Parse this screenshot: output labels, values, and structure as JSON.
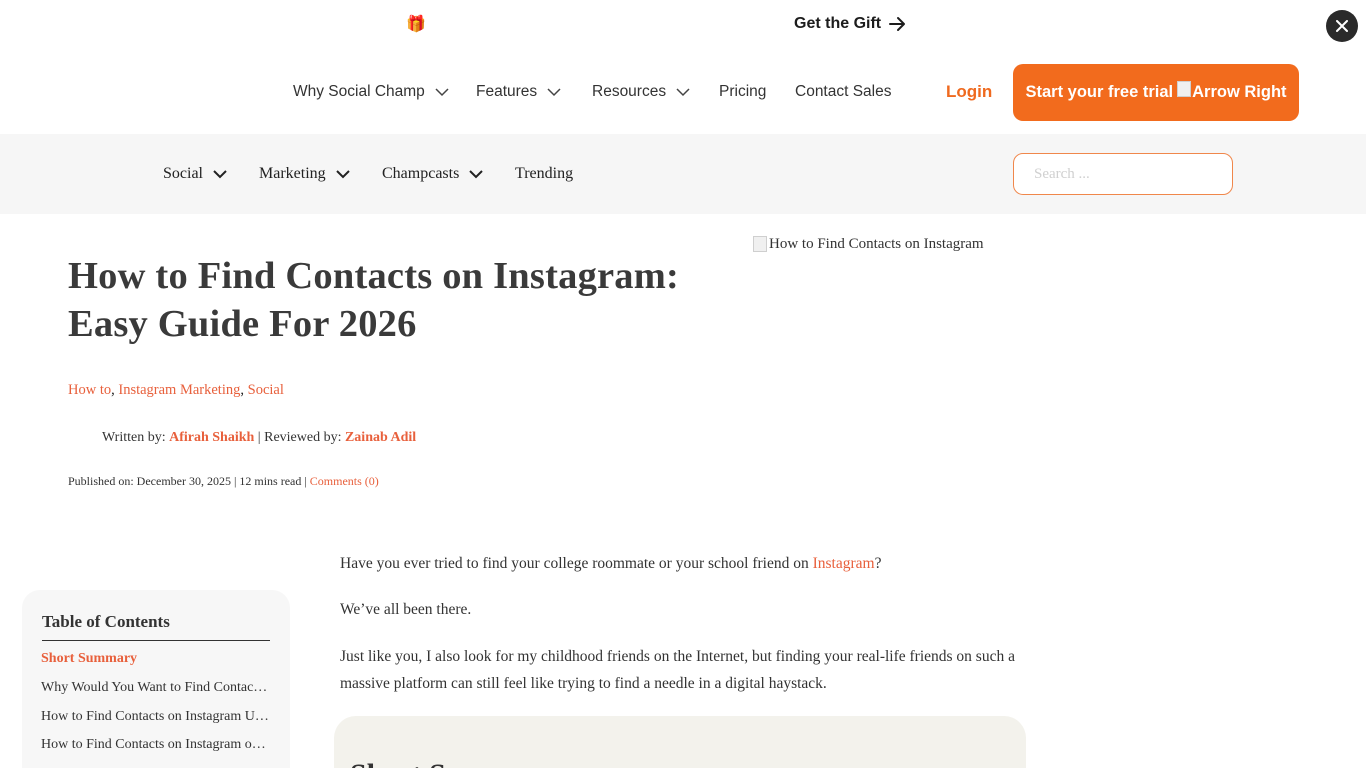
{
  "promo": {
    "gift_icon": "gift-icon",
    "link_label": "Get the Gift",
    "close_icon": "close-icon"
  },
  "main_nav": {
    "items": [
      {
        "label": "Why Social Champ",
        "has_dropdown": true
      },
      {
        "label": "Features",
        "has_dropdown": true
      },
      {
        "label": "Resources",
        "has_dropdown": true
      },
      {
        "label": "Pricing",
        "has_dropdown": false
      },
      {
        "label": "Contact Sales",
        "has_dropdown": false
      }
    ],
    "login_label": "Login",
    "cta_label": "Start your free trial",
    "cta_icon_alt": "Arrow Right"
  },
  "sub_nav": {
    "items": [
      {
        "label": "Social",
        "has_dropdown": true
      },
      {
        "label": "Marketing",
        "has_dropdown": true
      },
      {
        "label": "Champcasts",
        "has_dropdown": true
      },
      {
        "label": "Trending",
        "has_dropdown": false
      }
    ],
    "search_placeholder": "Search ...",
    "search_value": ""
  },
  "article": {
    "title": "How to Find Contacts on Instagram: Easy Guide For 2026",
    "hero_image_alt": "How to Find Contacts on Instagram",
    "categories": [
      "How to",
      "Instagram Marketing",
      "Social"
    ],
    "written_by_label": "Written by:",
    "author": "Afirah Shaikh",
    "reviewed_by_label": "| Reviewed by:",
    "reviewer": "Zainab Adil",
    "published_label": "Published on: December 30, 2025 | 12 mins read |",
    "comments_label": "Comments (0)",
    "paragraphs": {
      "p1_before": "Have you ever tried to find your college roommate or your school friend on ",
      "p1_link": "Instagram",
      "p1_after": "?",
      "p2": "We’ve all been there.",
      "p3": "Just like you, I also look for my childhood friends on the Internet, but finding your real-life friends on such a massive platform can still feel like trying to find a needle in a digital haystack."
    },
    "summary_heading": "Short Summary"
  },
  "toc": {
    "title": "Table of Contents",
    "items": [
      {
        "label": "Short Summary",
        "active": true
      },
      {
        "label": "Why Would You Want to Find Contacts on Instagram?",
        "active": false
      },
      {
        "label": "How to Find Contacts on Instagram Using the App",
        "active": false
      },
      {
        "label": "How to Find Contacts on Instagram on Desktop",
        "active": false
      }
    ]
  },
  "colors": {
    "accent": "#f26b1d",
    "link": "#e8603c",
    "subnav_bg": "#f6f6f6",
    "toc_bg": "#f7f7f7",
    "summary_bg": "#f3f2ec"
  }
}
